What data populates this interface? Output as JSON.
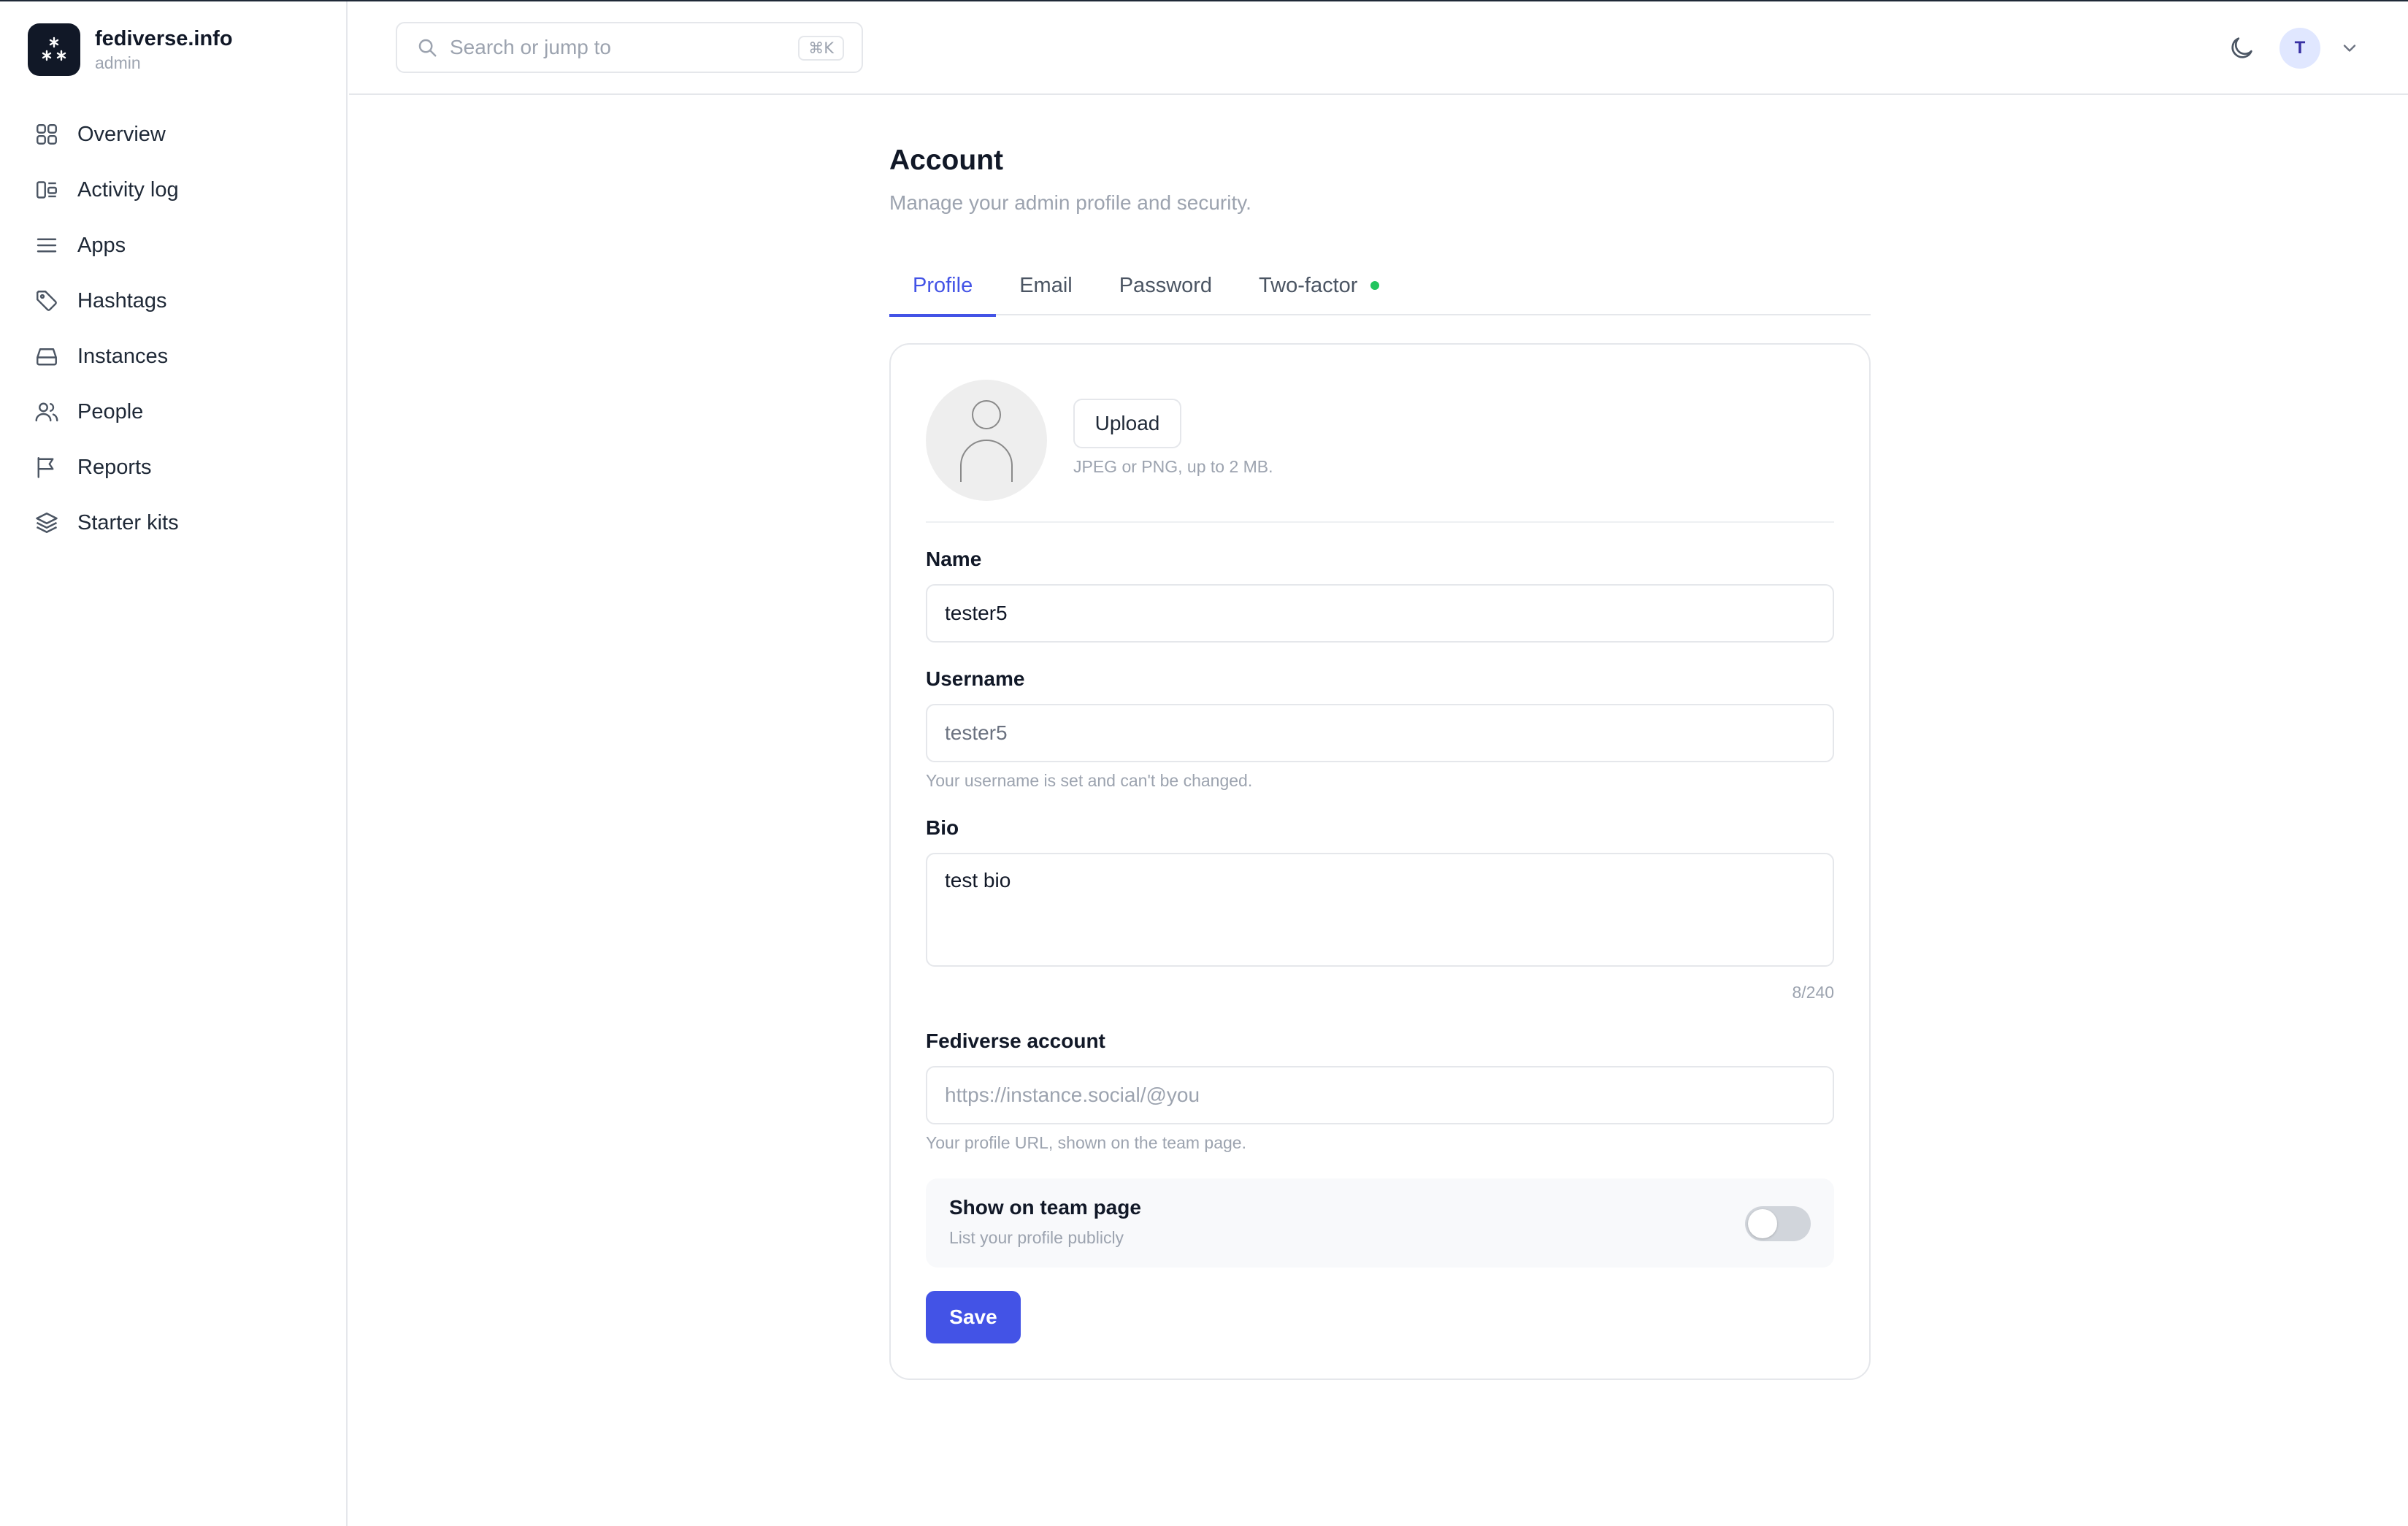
{
  "brand": {
    "title": "fediverse.info",
    "subtitle": "admin"
  },
  "sidebar": {
    "items": [
      {
        "label": "Overview",
        "icon": "grid-icon"
      },
      {
        "label": "Activity log",
        "icon": "activity-icon"
      },
      {
        "label": "Apps",
        "icon": "menu-icon"
      },
      {
        "label": "Hashtags",
        "icon": "tag-icon"
      },
      {
        "label": "Instances",
        "icon": "server-icon"
      },
      {
        "label": "People",
        "icon": "users-icon"
      },
      {
        "label": "Reports",
        "icon": "flag-icon"
      },
      {
        "label": "Starter kits",
        "icon": "layers-icon"
      }
    ]
  },
  "header": {
    "search_placeholder": "Search or jump to",
    "shortcut": "⌘K",
    "user_initial": "T"
  },
  "page": {
    "title": "Account",
    "subtitle": "Manage your admin profile and security."
  },
  "tabs": [
    {
      "label": "Profile",
      "active": true
    },
    {
      "label": "Email",
      "active": false
    },
    {
      "label": "Password",
      "active": false
    },
    {
      "label": "Two-factor",
      "active": false,
      "status_color": "#22c55e"
    }
  ],
  "profile": {
    "upload_label": "Upload",
    "upload_hint": "JPEG or PNG, up to 2 MB.",
    "name": {
      "label": "Name",
      "value": "tester5"
    },
    "username": {
      "label": "Username",
      "value": "tester5",
      "hint": "Your username is set and can't be changed."
    },
    "bio": {
      "label": "Bio",
      "value": "test bio",
      "counter": "8/240"
    },
    "fediverse": {
      "label": "Fediverse account",
      "placeholder": "https://instance.social/@you",
      "hint": "Your profile URL, shown on the team page."
    },
    "team_page": {
      "title": "Show on team page",
      "subtitle": "List your profile publicly",
      "enabled": false
    },
    "save_label": "Save"
  },
  "colors": {
    "accent": "#4353e6",
    "status_ok": "#22c55e"
  }
}
